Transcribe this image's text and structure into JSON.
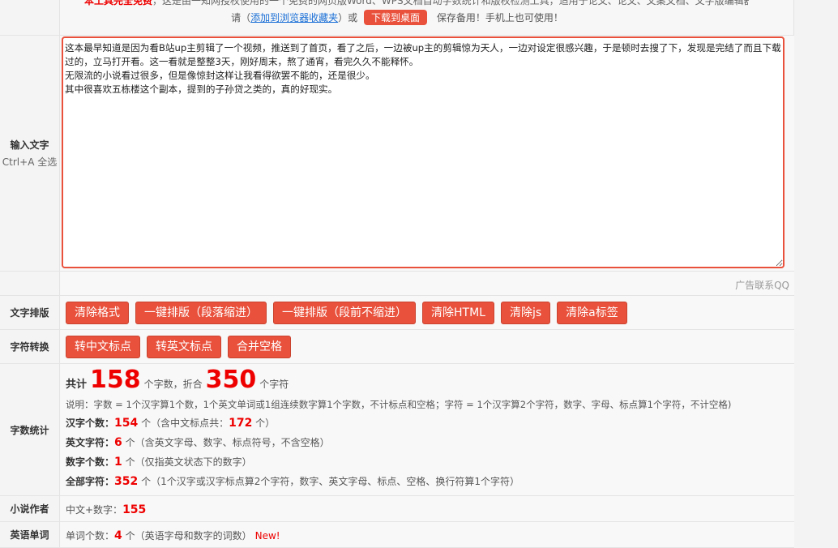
{
  "top": {
    "notice_red": "本工具完全免费",
    "notice_rest": "，这是由一知网授权使用的一个免费的网页版Word、WPS文档自动字数统计和版权检测工具，适用于论文、论文、文案文档、文字版编辑器！",
    "prefix": "请（",
    "bookmark_link": "添加到浏览器收藏夹",
    "or_text": "）或",
    "download_button": "下载到桌面",
    "suffix": "保存备用！手机上也可使用！"
  },
  "input": {
    "label": "输入文字",
    "sub_label": "Ctrl+A 全选",
    "text": "这本最早知道是因为看B站up主剪辑了一个视频，推送到了首页，看了之后，一边被up主的剪辑惊为天人，一边对设定很感兴趣，于是顿时去搜了下，发现是完结了而且下载过的，立马打开看。这一看就是整整3天，刚好周末，熬了通宵，看完久久不能释怀。\n无限流的小说看过很多，但是像惊封这样让我看得欲罢不能的，还是很少。\n其中很喜欢五栋楼这个副本，提到的子孙贷之类的，真的好现实。"
  },
  "ad": {
    "text": "广告联系QQ"
  },
  "format": {
    "label": "文字排版",
    "buttons": [
      "清除格式",
      "一键排版（段落缩进）",
      "一键排版（段前不缩进）",
      "清除HTML",
      "清除js",
      "清除a标签"
    ]
  },
  "convert": {
    "label": "字符转换",
    "buttons": [
      "转中文标点",
      "转英文标点",
      "合并空格"
    ]
  },
  "stats": {
    "label": "字数统计",
    "total_prefix": "共计",
    "word_count": "158",
    "word_unit": "个字数，折合",
    "char_count": "350",
    "char_unit": "个字符",
    "note": "说明：字数 = 1个汉字算1个数，1个英文单词或1组连续数字算1个字数，不计标点和空格；字符 = 1个汉字算2个字符，数字、字母、标点算1个字符，不计空格)",
    "hanzi_label": "汉字个数：",
    "hanzi_count": "154",
    "hanzi_unit": "个",
    "hanzi_note": "（含中文标点共：",
    "hanzi_with_punct": "172",
    "hanzi_note_end": "个）",
    "english_label": "英文字符：",
    "english_count": "6",
    "english_unit": "个",
    "english_note": "（含英文字母、数字、标点符号，不含空格）",
    "digit_label": "数字个数：",
    "digit_count": "1",
    "digit_unit": "个",
    "digit_note": "（仅指英文状态下的数字）",
    "all_label": "全部字符：",
    "all_count": "352",
    "all_unit": "个",
    "all_note": "（1个汉字或汉字标点算2个字符，数字、英文字母、标点、空格、换行符算1个字符）"
  },
  "novel": {
    "label": "小说作者",
    "text": "中文+数字：",
    "count": "155"
  },
  "english_words": {
    "label": "英语单词",
    "text": "单词个数：",
    "count": "4",
    "unit": "个",
    "note": "（英语字母和数字的词数）",
    "new_tag": "New!"
  }
}
